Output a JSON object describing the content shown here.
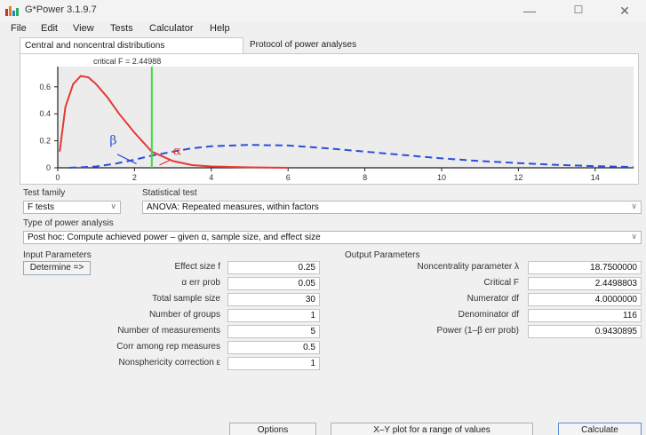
{
  "window": {
    "title": "G*Power 3.1.9.7",
    "controls": {
      "minimize": "—",
      "maximize": "☐",
      "close": "✕"
    }
  },
  "menu": [
    "File",
    "Edit",
    "View",
    "Tests",
    "Calculator",
    "Help"
  ],
  "tabs": [
    {
      "label": "Central and noncentral distributions",
      "active": true
    },
    {
      "label": "Protocol of power analyses",
      "active": false
    }
  ],
  "chart_data": {
    "type": "line",
    "annotation": "critical F =  2.44988",
    "critical_value": 2.44988,
    "xlim": [
      0,
      15
    ],
    "ylim": [
      0,
      0.75
    ],
    "x_ticks": [
      "0",
      "2",
      "4",
      "6",
      "8",
      "10",
      "12",
      "14"
    ],
    "y_ticks": [
      "0",
      "0.2",
      "0.4",
      "0.6"
    ],
    "curve_labels": {
      "beta": "β",
      "alpha": "α"
    },
    "series": [
      {
        "style": "solid",
        "color": "#e53935",
        "x": [
          0.05,
          0.2,
          0.4,
          0.6,
          0.8,
          1.0,
          1.3,
          1.6,
          2.0,
          2.45,
          3.0,
          3.5,
          4.0,
          5.0,
          6.0
        ],
        "y": [
          0.12,
          0.45,
          0.62,
          0.68,
          0.67,
          0.62,
          0.52,
          0.4,
          0.26,
          0.12,
          0.05,
          0.02,
          0.01,
          0.003,
          0.0
        ]
      },
      {
        "style": "dashed",
        "color": "#2b4fd8",
        "x": [
          0.3,
          1.0,
          1.5,
          2.0,
          2.45,
          3.0,
          3.5,
          4.0,
          5.0,
          6.0,
          7.0,
          8.0,
          9.0,
          10.0,
          11.0,
          12.0,
          13.0,
          14.0,
          15.0
        ],
        "y": [
          0.0,
          0.01,
          0.03,
          0.06,
          0.09,
          0.12,
          0.145,
          0.16,
          0.17,
          0.165,
          0.145,
          0.12,
          0.095,
          0.07,
          0.05,
          0.035,
          0.022,
          0.012,
          0.006
        ]
      }
    ]
  },
  "test_family": {
    "label": "Test family",
    "value": "F tests"
  },
  "statistical_test": {
    "label": "Statistical test",
    "value": "ANOVA: Repeated measures, within factors"
  },
  "power_analysis": {
    "label": "Type of power analysis",
    "value": "Post hoc: Compute achieved power – given α, sample size, and effect size"
  },
  "input": {
    "heading": "Input Parameters",
    "determine_button": "Determine =>",
    "params": [
      {
        "label": "Effect size f",
        "value": "0.25"
      },
      {
        "label": "α err prob",
        "value": "0.05"
      },
      {
        "label": "Total sample size",
        "value": "30"
      },
      {
        "label": "Number of groups",
        "value": "1"
      },
      {
        "label": "Number of measurements",
        "value": "5"
      },
      {
        "label": "Corr among rep measures",
        "value": "0.5"
      },
      {
        "label": "Nonsphericity correction ε",
        "value": "1"
      }
    ]
  },
  "output": {
    "heading": "Output Parameters",
    "params": [
      {
        "label": "Noncentrality parameter λ",
        "value": "18.7500000"
      },
      {
        "label": "Critical F",
        "value": "2.4498803"
      },
      {
        "label": "Numerator df",
        "value": "4.0000000"
      },
      {
        "label": "Denominator df",
        "value": "116"
      },
      {
        "label": "Power (1–β err prob)",
        "value": "0.9430895"
      }
    ]
  },
  "buttons": {
    "options": "Options",
    "xy_plot": "X–Y plot for a range of values",
    "calculate": "Calculate"
  }
}
